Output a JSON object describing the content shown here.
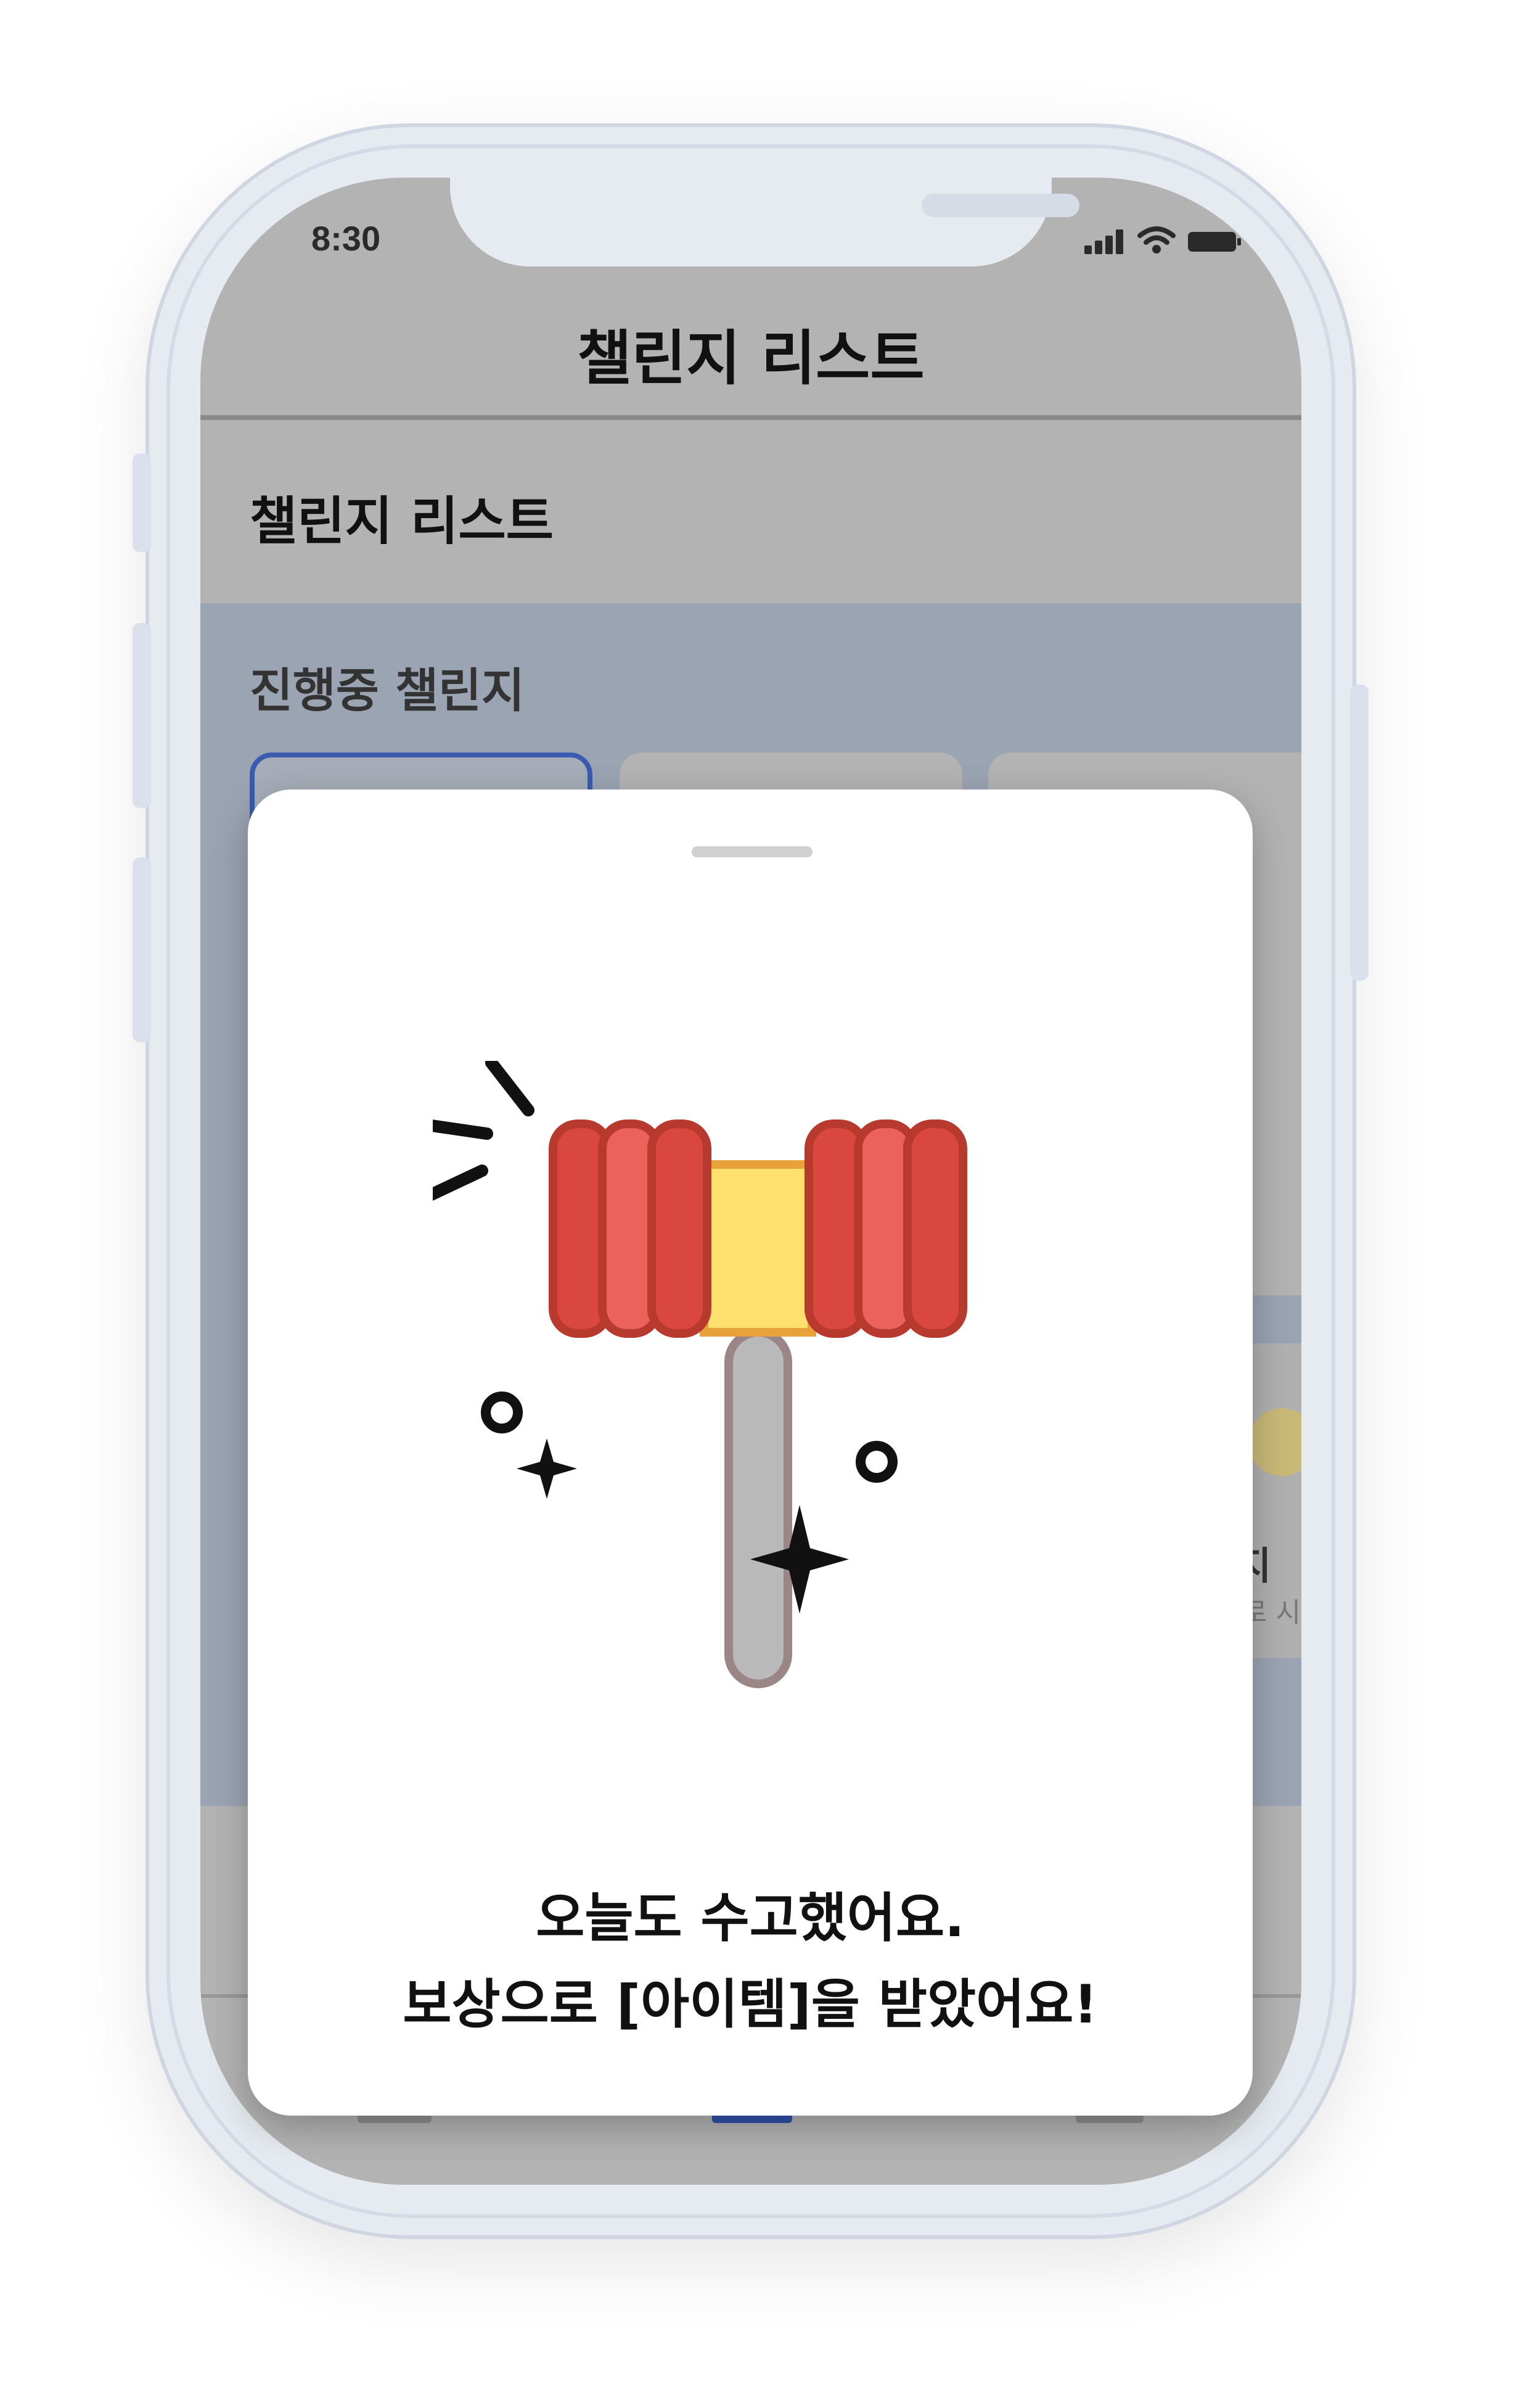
{
  "status_bar": {
    "time": "8:30",
    "icons": [
      "signal-icon",
      "wifi-icon",
      "battery-icon"
    ]
  },
  "nav": {
    "title": "챌린지 리스트"
  },
  "section": {
    "title": "챌린지 리스트",
    "ongoing_label": "진행중 챌린지"
  },
  "background_peek": {
    "text_fragment": "지 (",
    "sub_fragment": "로 시"
  },
  "reward_sheet": {
    "illustration": "gavel-icon",
    "message_line1": "오늘도 수고했어요.",
    "message_line2": "보상으로 [아이템]을 받았어요!"
  },
  "colors": {
    "screen_dim": "#b3b3b3",
    "content_dim": "#9ba4b3",
    "active_card_border": "#3a5bb0",
    "gavel_red": "#d9473f",
    "gavel_red_light": "#ec625a",
    "gavel_band": "#ffdf6e",
    "gavel_handle": "#b9b9b9"
  }
}
